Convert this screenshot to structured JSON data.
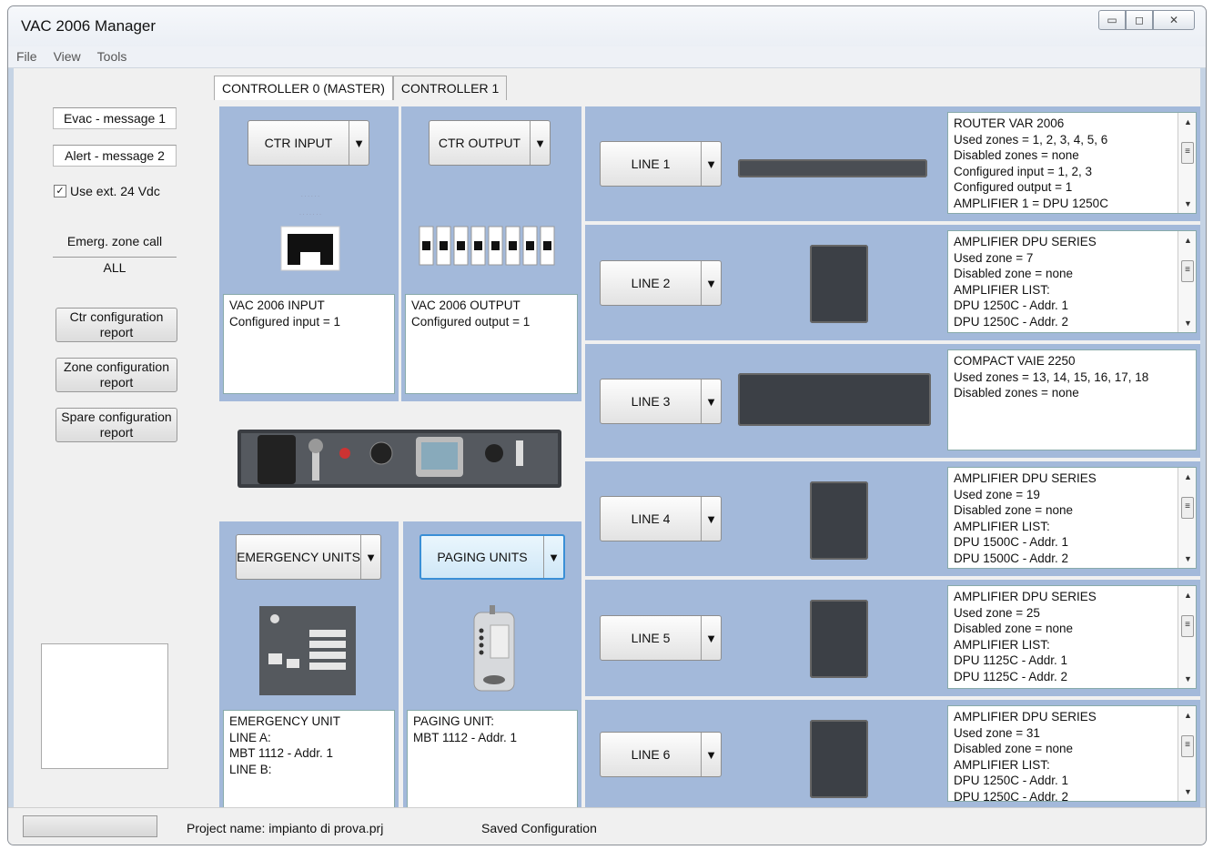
{
  "window": {
    "title": "VAC 2006 Manager"
  },
  "menu": [
    "File",
    "View",
    "Tools"
  ],
  "left": {
    "evac_message": "Evac - message 1",
    "alert_message": "Alert - message 2",
    "use_ext_label": "Use ext. 24 Vdc",
    "use_ext_checked": true,
    "emerg_zone_label": "Emerg. zone call",
    "emerg_zone_value": "ALL",
    "buttons": [
      "Ctr configuration report",
      "Zone configuration report",
      "Spare configuration report"
    ]
  },
  "tabs": [
    "CONTROLLER 0 (MASTER)",
    "CONTROLLER 1"
  ],
  "ctr": {
    "input_button": "CTR INPUT",
    "output_button": "CTR OUTPUT",
    "input_info": "VAC 2006 INPUT\nConfigured input = 1",
    "output_info": "VAC 2006 OUTPUT\nConfigured output = 1"
  },
  "units": {
    "emergency_button": "EMERGENCY UNITS",
    "paging_button": "PAGING UNITS",
    "emergency_info": "EMERGENCY UNIT\nLINE A:\nMBT 1112 - Addr. 1\nLINE B:",
    "paging_info": "PAGING UNIT:\nMBT 1112 - Addr. 1"
  },
  "lines": [
    {
      "label": "LINE 1",
      "info": "ROUTER VAR 2006\nUsed zones = 1, 2, 3, 4, 5, 6\nDisabled zones = none\nConfigured input = 1, 2, 3\nConfigured output = 1\nAMPLIFIER 1 = DPU 1250C"
    },
    {
      "label": "LINE 2",
      "info": "AMPLIFIER DPU SERIES\nUsed zone = 7\nDisabled zone = none\nAMPLIFIER LIST:\nDPU 1250C - Addr. 1\nDPU 1250C - Addr. 2"
    },
    {
      "label": "LINE 3",
      "info": "COMPACT VAIE 2250\nUsed zones = 13, 14, 15, 16, 17, 18\nDisabled zones = none"
    },
    {
      "label": "LINE 4",
      "info": "AMPLIFIER DPU SERIES\nUsed zone = 19\nDisabled zone = none\nAMPLIFIER LIST:\nDPU 1500C - Addr. 1\nDPU 1500C - Addr. 2"
    },
    {
      "label": "LINE 5",
      "info": "AMPLIFIER DPU SERIES\nUsed zone = 25\nDisabled zone = none\nAMPLIFIER LIST:\nDPU 1125C - Addr. 1\nDPU 1125C - Addr. 2"
    },
    {
      "label": "LINE 6",
      "info": "AMPLIFIER DPU SERIES\nUsed zone = 31\nDisabled zone = none\nAMPLIFIER LIST:\nDPU 1250C - Addr. 1\nDPU 1250C - Addr. 2"
    }
  ],
  "status": {
    "project": "Project name: impianto di prova.prj",
    "state": "Saved Configuration"
  }
}
